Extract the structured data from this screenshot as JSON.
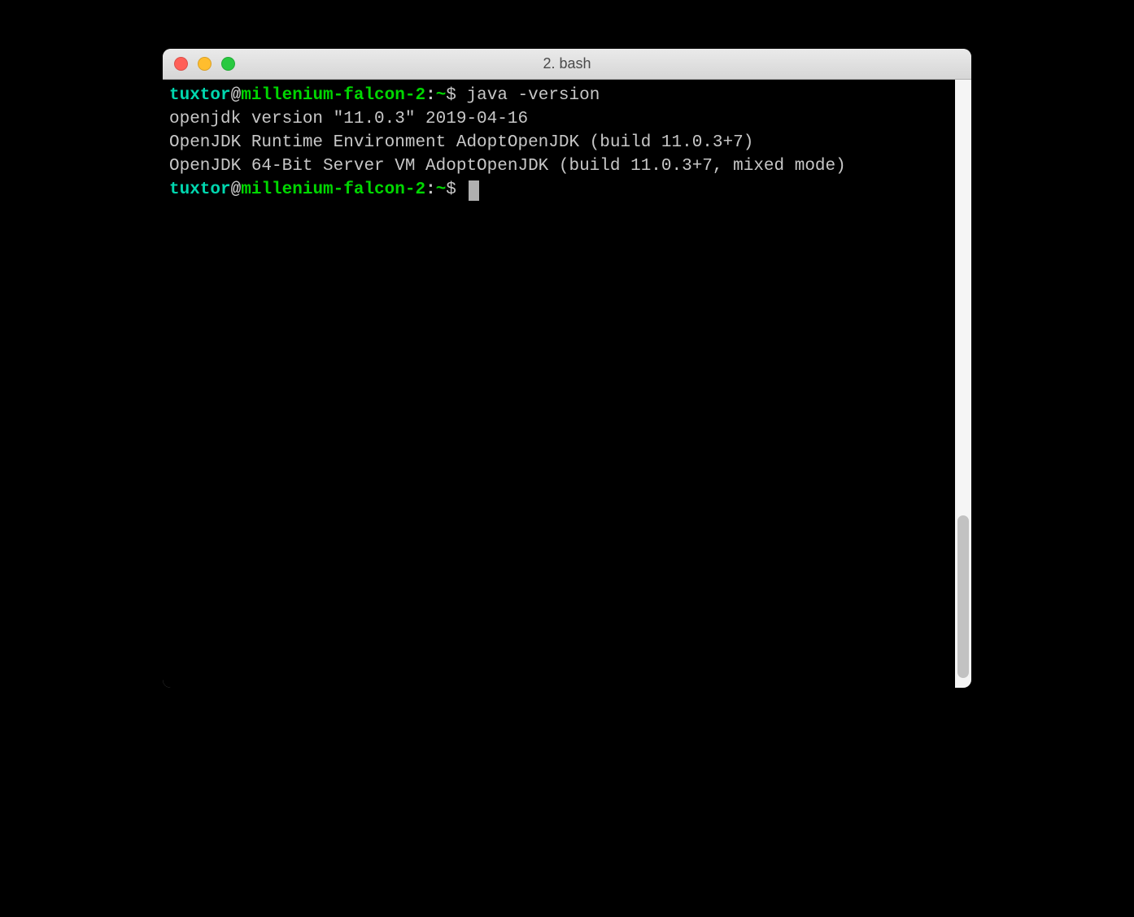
{
  "window": {
    "title": "2. bash"
  },
  "terminal": {
    "prompt1": {
      "user": "tuxtor",
      "at": "@",
      "host": "millenium-falcon-2",
      "colon": ":",
      "path": "~",
      "dollar": "$ ",
      "command": "java -version"
    },
    "output": {
      "line1": "openjdk version \"11.0.3\" 2019-04-16",
      "line2": "OpenJDK Runtime Environment AdoptOpenJDK (build 11.0.3+7)",
      "line3": "OpenJDK 64-Bit Server VM AdoptOpenJDK (build 11.0.3+7, mixed mode)"
    },
    "prompt2": {
      "user": "tuxtor",
      "at": "@",
      "host": "millenium-falcon-2",
      "colon": ":",
      "path": "~",
      "dollar": "$ "
    }
  }
}
